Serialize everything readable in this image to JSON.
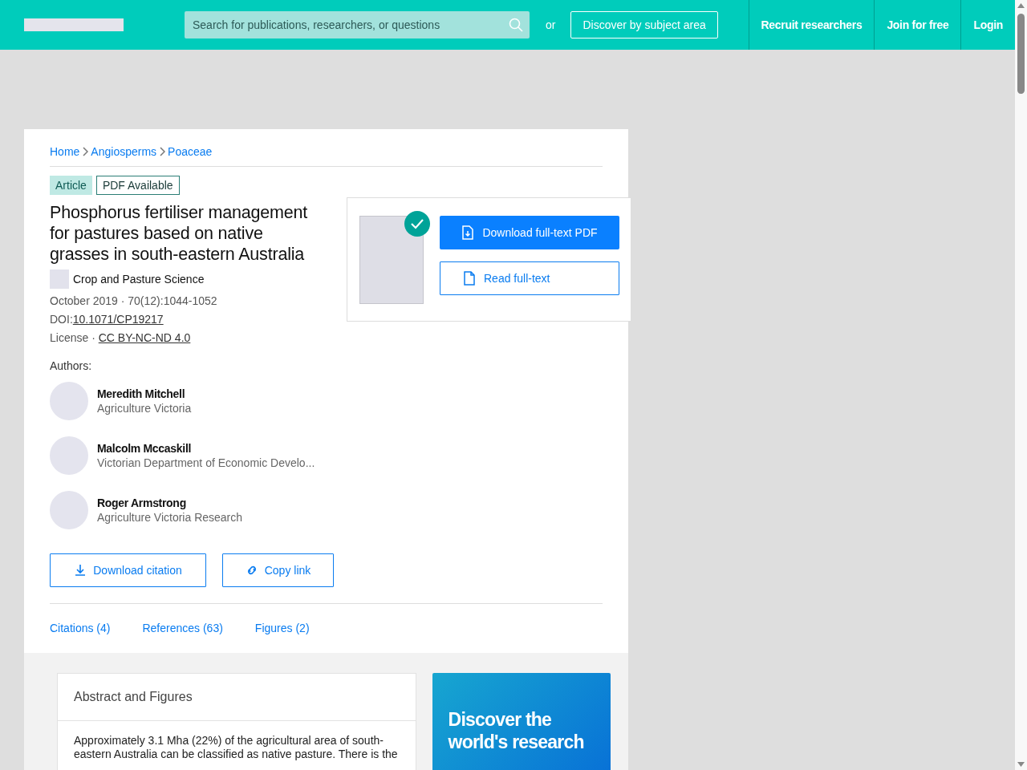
{
  "header": {
    "search": {
      "placeholder": "Search for publications, researchers, or questions"
    },
    "or_text": "or",
    "discover_button": "Discover by subject area",
    "nav": [
      "Recruit researchers",
      "Join for free",
      "Login"
    ]
  },
  "breadcrumbs": [
    "Home",
    "Angiosperms",
    "Poaceae"
  ],
  "badges": [
    {
      "label": "Article",
      "kind": "filled"
    },
    {
      "label": "PDF Available",
      "kind": "outlined"
    }
  ],
  "title": "Phosphorus fertiliser management for pastures based on native grasses in south-eastern Australia",
  "journal": "Crop and Pasture Science",
  "date_line": "October 2019 · 70(12):1044-1052",
  "doi": {
    "label": "DOI:",
    "link": "10.1071/CP19217"
  },
  "license": {
    "label": "License · ",
    "link": "CC BY-NC-ND 4.0"
  },
  "authors_label": "Authors:",
  "authors": [
    {
      "name": "Meredith Mitchell",
      "affiliation": "Agriculture Victoria"
    },
    {
      "name": "Malcolm Mccaskill",
      "affiliation": "Victorian Department of Economic Develo..."
    },
    {
      "name": "Roger Armstrong",
      "affiliation": "Agriculture Victoria Research"
    }
  ],
  "actions": [
    "Download citation",
    "Copy link"
  ],
  "tabs": [
    {
      "label": "Citations (4)",
      "selected": false
    },
    {
      "label": "References (63)",
      "selected": false
    },
    {
      "label": "Figures (2)",
      "selected": false
    }
  ],
  "fulltext": {
    "available": true,
    "download_button": "Download full-text PDF",
    "read_button": "Read full-text"
  },
  "abstract": {
    "heading": "Abstract and Figures",
    "text": "Approximately 3.1 Mha (22%) of the agricultural area of south-eastern Australia can be classified as native pasture. There is the"
  },
  "promo": {
    "heading": "Discover the world's research"
  }
}
